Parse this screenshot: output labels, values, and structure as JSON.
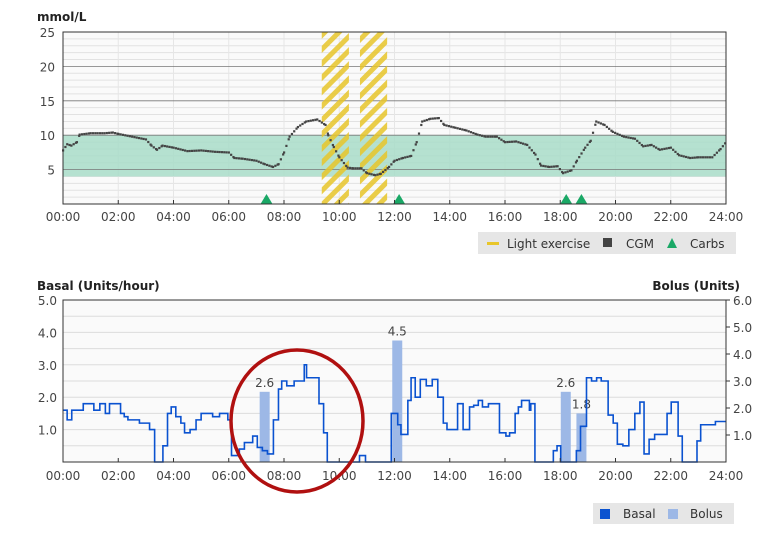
{
  "chart_data": [
    {
      "type": "scatter",
      "ylabel": "mmol/L",
      "ylim": [
        0,
        25
      ],
      "yticks": [
        "5",
        "10",
        "15",
        "20",
        "25"
      ],
      "xticks": [
        "00:00",
        "02:00",
        "04:00",
        "06:00",
        "08:00",
        "10:00",
        "12:00",
        "14:00",
        "16:00",
        "18:00",
        "20:00",
        "22:00",
        "24:00"
      ],
      "grid": true,
      "target_range": [
        4,
        10
      ],
      "legend_position": "bottom-right",
      "legend": {
        "exercise": "Light exercise",
        "cgm": "CGM",
        "carbs": "Carbs"
      },
      "colors": {
        "cgm": "#444444",
        "target": "#a8dcc8",
        "exercise": "#e8c62a",
        "carbs": "#1aa866"
      },
      "exercise_periods": [
        [
          "09:22",
          "10:21"
        ],
        [
          "10:45",
          "11:44"
        ]
      ],
      "carbs_times": [
        "07:22",
        "12:10",
        "18:13",
        "18:46"
      ],
      "cgm": [
        [
          "00:00",
          7.8
        ],
        [
          "00:09",
          8.7
        ],
        [
          "00:18",
          8.5
        ],
        [
          "00:30",
          9.0
        ],
        [
          "00:36",
          10.1
        ],
        [
          "01:00",
          10.3
        ],
        [
          "01:30",
          10.3
        ],
        [
          "01:48",
          10.4
        ],
        [
          "02:00",
          10.2
        ],
        [
          "02:30",
          9.8
        ],
        [
          "03:00",
          9.4
        ],
        [
          "03:12",
          8.5
        ],
        [
          "03:24",
          7.9
        ],
        [
          "03:36",
          8.5
        ],
        [
          "04:00",
          8.2
        ],
        [
          "04:30",
          7.7
        ],
        [
          "05:00",
          7.8
        ],
        [
          "05:30",
          7.6
        ],
        [
          "06:00",
          7.5
        ],
        [
          "06:12",
          6.7
        ],
        [
          "06:30",
          6.6
        ],
        [
          "07:00",
          6.3
        ],
        [
          "07:18",
          5.8
        ],
        [
          "07:36",
          5.4
        ],
        [
          "07:48",
          5.8
        ],
        [
          "08:00",
          7.5
        ],
        [
          "08:12",
          9.8
        ],
        [
          "08:30",
          11.2
        ],
        [
          "08:48",
          12.0
        ],
        [
          "09:12",
          12.3
        ],
        [
          "09:30",
          11.5
        ],
        [
          "09:36",
          10.0
        ],
        [
          "09:48",
          8.3
        ],
        [
          "10:00",
          6.8
        ],
        [
          "10:18",
          5.3
        ],
        [
          "10:30",
          5.2
        ],
        [
          "10:48",
          5.2
        ],
        [
          "11:00",
          4.5
        ],
        [
          "11:18",
          4.2
        ],
        [
          "11:30",
          4.4
        ],
        [
          "11:48",
          5.4
        ],
        [
          "12:00",
          6.3
        ],
        [
          "12:18",
          6.7
        ],
        [
          "12:36",
          7.0
        ],
        [
          "12:48",
          9.0
        ],
        [
          "13:00",
          12.0
        ],
        [
          "13:18",
          12.4
        ],
        [
          "13:36",
          12.5
        ],
        [
          "13:48",
          11.5
        ],
        [
          "14:12",
          11.1
        ],
        [
          "14:36",
          10.7
        ],
        [
          "15:00",
          10.1
        ],
        [
          "15:18",
          9.8
        ],
        [
          "15:42",
          9.8
        ],
        [
          "16:00",
          9.0
        ],
        [
          "16:24",
          9.1
        ],
        [
          "16:48",
          8.6
        ],
        [
          "17:06",
          7.2
        ],
        [
          "17:18",
          5.6
        ],
        [
          "17:36",
          5.4
        ],
        [
          "17:54",
          5.5
        ],
        [
          "18:06",
          4.5
        ],
        [
          "18:24",
          4.9
        ],
        [
          "18:36",
          6.3
        ],
        [
          "18:54",
          8.2
        ],
        [
          "19:06",
          9.2
        ],
        [
          "19:18",
          12.0
        ],
        [
          "19:36",
          11.5
        ],
        [
          "19:54",
          10.5
        ],
        [
          "20:18",
          9.8
        ],
        [
          "20:42",
          9.5
        ],
        [
          "21:00",
          8.4
        ],
        [
          "21:18",
          8.6
        ],
        [
          "21:36",
          7.9
        ],
        [
          "22:00",
          8.2
        ],
        [
          "22:18",
          7.1
        ],
        [
          "22:42",
          6.7
        ],
        [
          "23:00",
          6.8
        ],
        [
          "23:30",
          6.8
        ],
        [
          "23:48",
          8.0
        ],
        [
          "24:00",
          9.0
        ]
      ]
    },
    {
      "type": "bar",
      "ylabel": "Basal (Units/hour)",
      "y2label": "Bolus (Units)",
      "ylim": [
        0,
        5
      ],
      "y2lim": [
        0,
        6
      ],
      "yticks": [
        "1.0",
        "2.0",
        "3.0",
        "4.0",
        "5.0"
      ],
      "y2ticks": [
        "1.0",
        "2.0",
        "3.0",
        "4.0",
        "5.0",
        "6.0"
      ],
      "xticks": [
        "00:00",
        "02:00",
        "04:00",
        "06:00",
        "08:00",
        "10:00",
        "12:00",
        "14:00",
        "16:00",
        "18:00",
        "20:00",
        "22:00",
        "24:00"
      ],
      "grid": true,
      "legend_position": "bottom-right",
      "legend": {
        "basal": "Basal",
        "bolus": "Bolus"
      },
      "colors": {
        "basal": "#0a52d0",
        "bolus": "#9db8e6",
        "annotation": "#b01010"
      },
      "annotation": "red circle around 06:30–10:00",
      "basal_steps": [
        [
          "00:00",
          1.6
        ],
        [
          "00:09",
          1.3
        ],
        [
          "00:19",
          1.6
        ],
        [
          "00:44",
          1.8
        ],
        [
          "01:07",
          1.6
        ],
        [
          "01:20",
          1.8
        ],
        [
          "01:32",
          1.5
        ],
        [
          "01:41",
          1.8
        ],
        [
          "02:05",
          1.5
        ],
        [
          "02:13",
          1.4
        ],
        [
          "02:21",
          1.3
        ],
        [
          "02:46",
          1.2
        ],
        [
          "03:08",
          1.0
        ],
        [
          "03:19",
          0
        ],
        [
          "03:37",
          0.5
        ],
        [
          "03:47",
          1.5
        ],
        [
          "03:55",
          1.7
        ],
        [
          "04:05",
          1.4
        ],
        [
          "04:16",
          1.2
        ],
        [
          "04:24",
          0.9
        ],
        [
          "04:36",
          1.0
        ],
        [
          "04:49",
          1.3
        ],
        [
          "05:00",
          1.5
        ],
        [
          "05:25",
          1.4
        ],
        [
          "05:40",
          1.5
        ],
        [
          "05:58",
          1.3
        ],
        [
          "06:06",
          0.2
        ],
        [
          "06:23",
          0.4
        ],
        [
          "06:34",
          0.6
        ],
        [
          "06:52",
          0.8
        ],
        [
          "07:02",
          0.45
        ],
        [
          "07:13",
          0.35
        ],
        [
          "07:24",
          0.25
        ],
        [
          "07:37",
          1.3
        ],
        [
          "07:48",
          2.25
        ],
        [
          "07:55",
          2.5
        ],
        [
          "08:06",
          2.35
        ],
        [
          "08:22",
          2.5
        ],
        [
          "08:44",
          3.0
        ],
        [
          "08:49",
          2.6
        ],
        [
          "09:16",
          1.8
        ],
        [
          "09:26",
          0.9
        ],
        [
          "09:34",
          0
        ],
        [
          "10:44",
          0.2
        ],
        [
          "10:57",
          0
        ],
        [
          "11:53",
          1.5
        ],
        [
          "12:07",
          1.15
        ],
        [
          "12:14",
          0.85
        ],
        [
          "12:29",
          1.9
        ],
        [
          "12:36",
          2.6
        ],
        [
          "12:45",
          2.0
        ],
        [
          "12:56",
          2.55
        ],
        [
          "13:09",
          2.35
        ],
        [
          "13:22",
          2.55
        ],
        [
          "13:34",
          2.0
        ],
        [
          "13:46",
          1.2
        ],
        [
          "13:54",
          1.0
        ],
        [
          "14:17",
          1.8
        ],
        [
          "14:29",
          1.0
        ],
        [
          "14:43",
          1.7
        ],
        [
          "14:52",
          1.75
        ],
        [
          "15:02",
          1.9
        ],
        [
          "15:11",
          1.7
        ],
        [
          "15:24",
          1.8
        ],
        [
          "15:48",
          0.9
        ],
        [
          "16:02",
          0.8
        ],
        [
          "16:10",
          0.9
        ],
        [
          "16:22",
          1.5
        ],
        [
          "16:29",
          1.7
        ],
        [
          "16:36",
          1.9
        ],
        [
          "16:53",
          1.6
        ],
        [
          "16:56",
          1.8
        ],
        [
          "17:05",
          0
        ],
        [
          "17:45",
          0.35
        ],
        [
          "17:53",
          0.5
        ],
        [
          "18:01",
          0
        ],
        [
          "18:35",
          0.35
        ],
        [
          "18:44",
          1.1
        ],
        [
          "18:57",
          2.6
        ],
        [
          "19:08",
          2.5
        ],
        [
          "19:19",
          2.6
        ],
        [
          "19:29",
          2.5
        ],
        [
          "19:44",
          1.45
        ],
        [
          "19:55",
          1.2
        ],
        [
          "20:04",
          0.55
        ],
        [
          "20:16",
          0.5
        ],
        [
          "20:29",
          1.0
        ],
        [
          "20:42",
          1.5
        ],
        [
          "20:53",
          1.85
        ],
        [
          "21:02",
          0.25
        ],
        [
          "21:13",
          0.7
        ],
        [
          "21:25",
          0.85
        ],
        [
          "21:52",
          1.5
        ],
        [
          "22:01",
          1.85
        ],
        [
          "22:16",
          0.8
        ],
        [
          "22:25",
          0
        ],
        [
          "22:57",
          0.65
        ],
        [
          "23:05",
          1.15
        ],
        [
          "23:37",
          1.25
        ],
        [
          "24:00",
          1.25
        ]
      ],
      "bolus": [
        {
          "time": "07:18",
          "value": 2.6,
          "label": "2.6"
        },
        {
          "time": "12:06",
          "value": 4.5,
          "label": "4.5"
        },
        {
          "time": "18:12",
          "value": 2.6,
          "label": "2.6"
        },
        {
          "time": "18:46",
          "value": 1.8,
          "label": "1.8"
        }
      ]
    }
  ]
}
